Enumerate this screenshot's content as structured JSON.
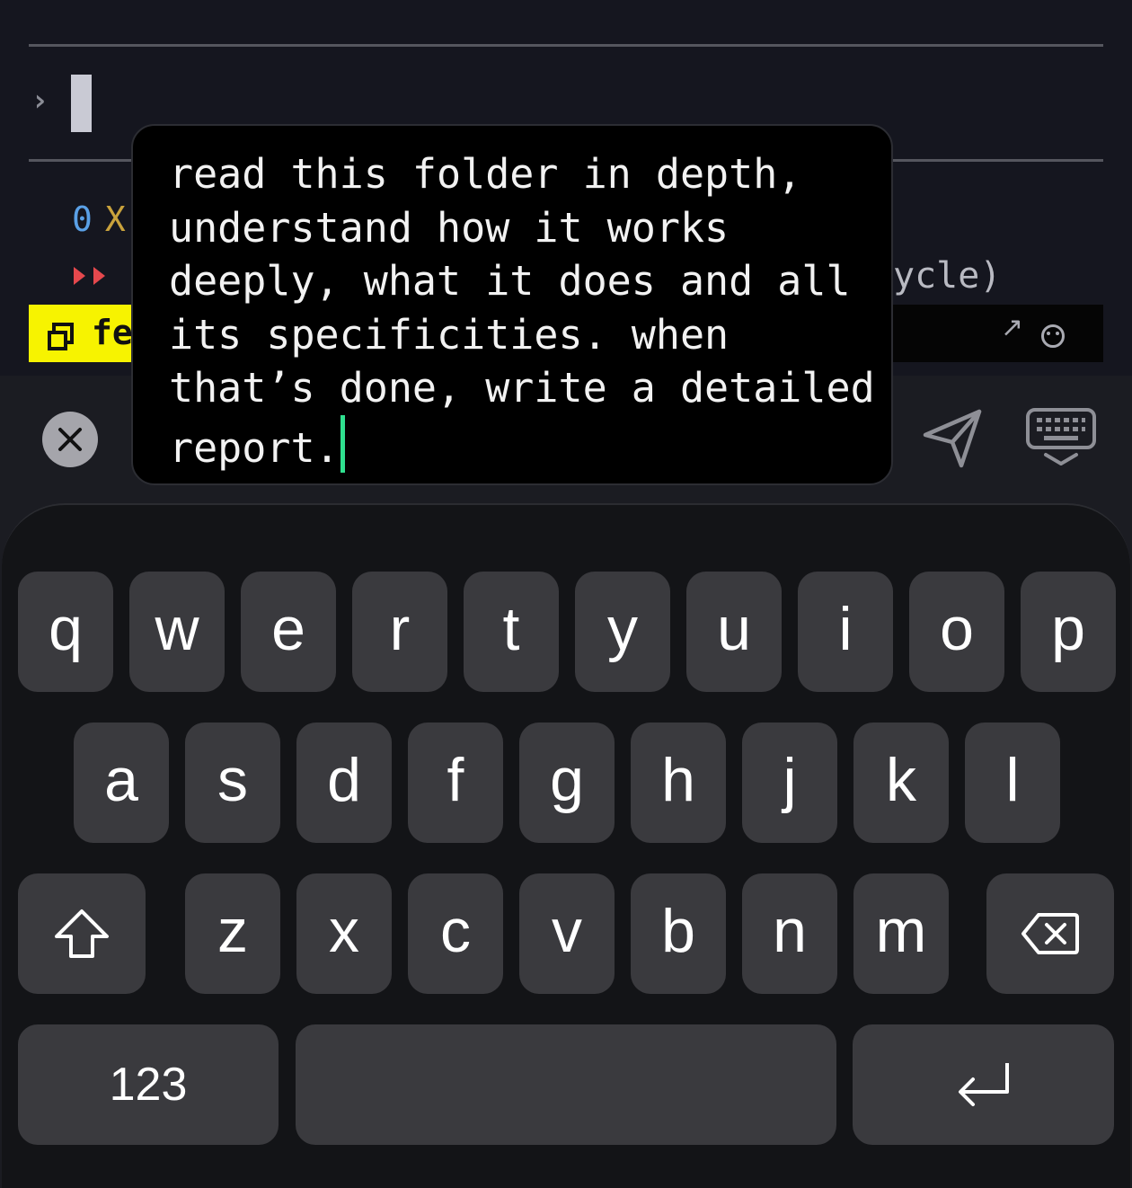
{
  "terminal": {
    "prompt_glyph": "›",
    "status_count": "0",
    "status_x": "X",
    "mode_hint": "ycle)",
    "badge_text": "fe",
    "bar_arrow": "↗"
  },
  "input": {
    "text": "read this folder in depth, understand how it works deeply, what it does and all its specificities. when that’s done, write a detailed report."
  },
  "toolbar": {
    "close_icon": "close-icon",
    "send_icon": "send-icon",
    "keyboard_icon": "keyboard-dismiss-icon"
  },
  "keyboard": {
    "row1": [
      "q",
      "w",
      "e",
      "r",
      "t",
      "y",
      "u",
      "i",
      "o",
      "p"
    ],
    "row2": [
      "a",
      "s",
      "d",
      "f",
      "g",
      "h",
      "j",
      "k",
      "l"
    ],
    "row3": [
      "z",
      "x",
      "c",
      "v",
      "b",
      "n",
      "m"
    ],
    "numbers_key": "123",
    "space_key": "",
    "shift_icon": "shift-icon",
    "delete_icon": "delete-icon",
    "return_icon": "return-icon"
  },
  "colors": {
    "cursor": "#2fe08f",
    "badge": "#f7f300",
    "key": "#3a3a3e"
  }
}
